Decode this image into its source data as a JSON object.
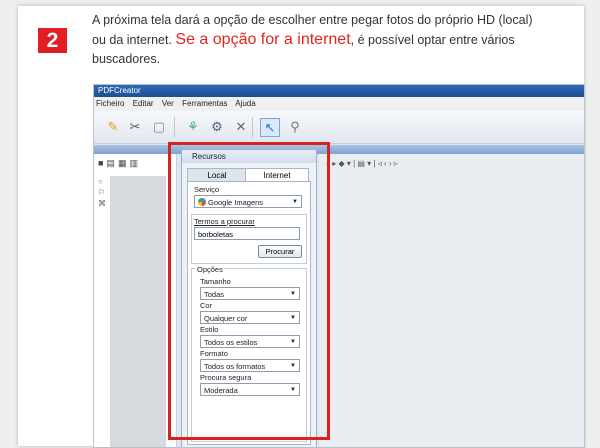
{
  "step_number": "2",
  "instruction": {
    "line1": "A próxima tela dará a opção de escolher entre pegar fotos do próprio HD (local)",
    "line2_start": "ou da internet. ",
    "line2_red": "Se a opção for a internet",
    "line2_end": ", é possível optar entre vários",
    "line3": "buscadores."
  },
  "window": {
    "title": "PDFCreator",
    "menu": [
      "Ficheiro",
      "Editar",
      "Ver",
      "Ferramentas",
      "Ajuda"
    ]
  },
  "panel": {
    "title": "Recursos",
    "tabs": {
      "local": "Local",
      "internet": "Internet"
    },
    "service_label": "Serviço",
    "service_value": "Google Imagens",
    "search_terms_label": "Termos a procurar",
    "search_terms_value": "borboletas",
    "search_button": "Procurar",
    "options_label": "Opções",
    "size_label": "Tamanho",
    "size_value": "Todas",
    "color_label": "Cor",
    "color_value": "Qualquer cor",
    "style_label": "Estilo",
    "style_value": "Todos os estilos",
    "format_label": "Formato",
    "format_value": "Todos os formatos",
    "safe_label": "Procura segura",
    "safe_value": "Moderada"
  },
  "colors": {
    "step_red": "#e31d24",
    "highlight_red": "#d8221d"
  }
}
